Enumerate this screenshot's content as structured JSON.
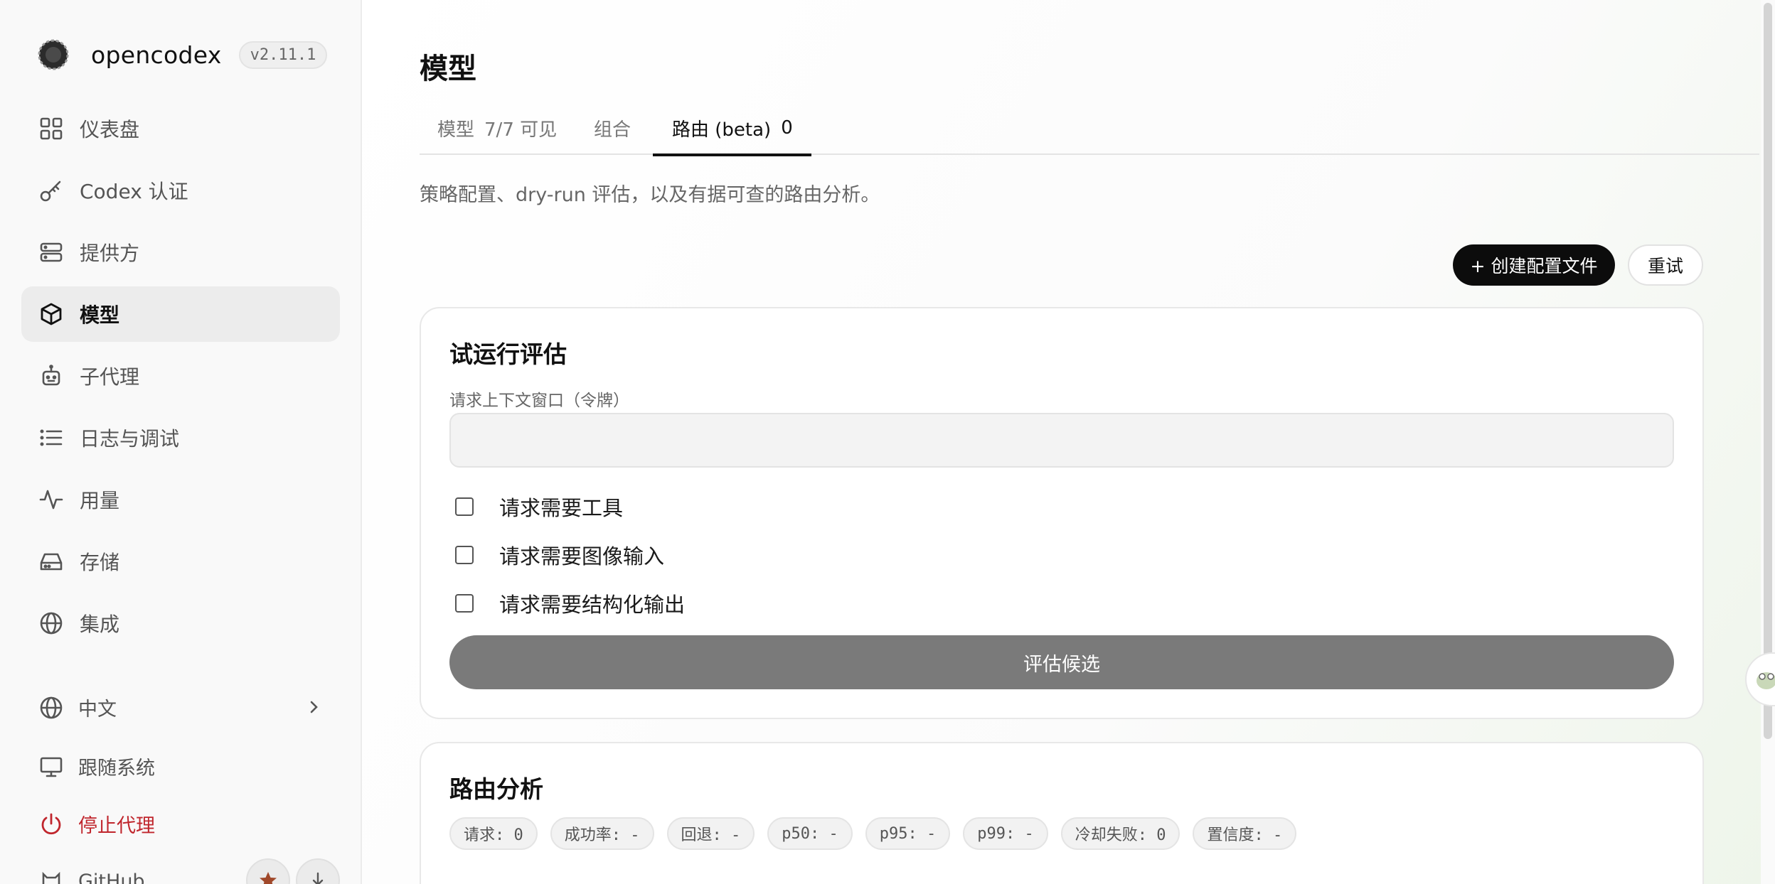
{
  "brand": {
    "name": "opencodex",
    "version": "v2.11.1"
  },
  "sidebar": {
    "items": [
      {
        "label": "仪表盘",
        "icon": "dashboard-grid-icon"
      },
      {
        "label": "Codex 认证",
        "icon": "key-icon"
      },
      {
        "label": "提供方",
        "icon": "server-icon"
      },
      {
        "label": "模型",
        "icon": "cube-icon",
        "active": true
      },
      {
        "label": "子代理",
        "icon": "robot-icon"
      },
      {
        "label": "日志与调试",
        "icon": "list-icon"
      },
      {
        "label": "用量",
        "icon": "activity-icon"
      },
      {
        "label": "存储",
        "icon": "hard-drive-icon"
      },
      {
        "label": "集成",
        "icon": "globe-icon"
      }
    ],
    "language": "中文",
    "theme": "跟随系统",
    "stop_proxy": "停止代理",
    "github": "GitHub"
  },
  "main": {
    "title": "模型",
    "tabs": [
      {
        "label": "模型",
        "count": "7/7 可见"
      },
      {
        "label": "组合",
        "count": ""
      },
      {
        "label": "路由 (beta)",
        "count": "0",
        "active": true
      }
    ],
    "subtitle": "策略配置、dry-run 评估，以及有据可查的路由分析。",
    "create_button": "+ 创建配置文件",
    "retry_button": "重试"
  },
  "dry_run": {
    "title": "试运行评估",
    "context_label": "请求上下文窗口（令牌）",
    "context_value": "",
    "checkboxes": [
      {
        "label": "请求需要工具",
        "checked": false
      },
      {
        "label": "请求需要图像输入",
        "checked": false
      },
      {
        "label": "请求需要结构化输出",
        "checked": false
      }
    ],
    "evaluate_button": "评估候选"
  },
  "analytics": {
    "title": "路由分析",
    "stats": [
      "请求: 0",
      "成功率: -",
      "回退: -",
      "p50: -",
      "p95: -",
      "p99: -",
      "冷却失败: 0",
      "置信度: -"
    ]
  },
  "colors": {
    "accent_black": "#0c0c0c",
    "stop_red": "#c0262d",
    "active_nav_bg": "#ececec",
    "eval_button_gray": "#7a7a7a"
  }
}
